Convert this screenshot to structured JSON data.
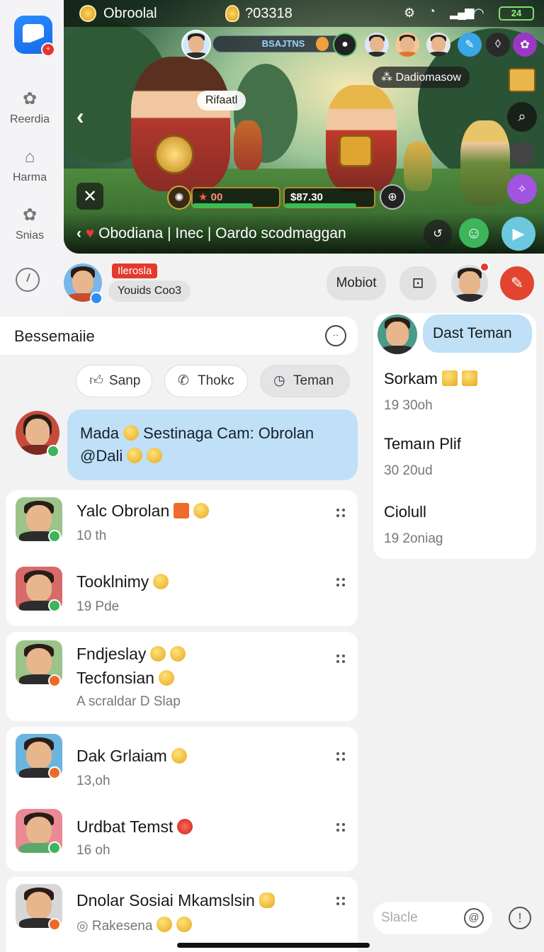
{
  "rail": {
    "items": [
      {
        "label": "Reerdia",
        "icon": "puzzle-icon"
      },
      {
        "label": "Harma",
        "icon": "home-icon"
      },
      {
        "label": "Snias",
        "icon": "puzzle-icon"
      }
    ]
  },
  "stream": {
    "coin_label": "Obroolal",
    "bulb_value": "?03318",
    "battery": "24",
    "hud_label": "BSAJTNS",
    "speech": "Rifaatl",
    "viewer_chip": "Dadiomasow",
    "hp_left": "00",
    "hp_right": "$87.30",
    "ticker": "Obodiana | Inec | Oardo scodmaggan",
    "accent": "#3cb55b"
  },
  "host": {
    "tag": "Ileroslа",
    "name": "Youids Coo3",
    "button": "Mobiot"
  },
  "search": {
    "title": "Bessemaiie"
  },
  "filters": [
    {
      "label": "Sanp",
      "icon": "thumbs-up-icon"
    },
    {
      "label": "Thokc",
      "icon": "phone-icon"
    },
    {
      "label": "Teman",
      "icon": "clock-icon"
    }
  ],
  "pinned": {
    "line1": "Mada",
    "line1b": "Sestinaga Cam: Obrolan",
    "line2": "@Dali"
  },
  "chats": [
    {
      "name": "Yalc Obrolan",
      "sub": "10 th"
    },
    {
      "name": "Tooklnimy",
      "sub": "19 Pde"
    },
    {
      "name": "Fndjeslay",
      "name2": "Tecfonsian",
      "sub": "A scraldar D Slap"
    },
    {
      "name": "Dak Grlaiam",
      "sub": "13,oh"
    },
    {
      "name": "Urdbat Temst",
      "sub": "16 oh"
    },
    {
      "name": "Dnolar Sosiai Mkamslsin",
      "sub": "Rakesena"
    }
  ],
  "right_panel": {
    "bubble": "Dast Teman",
    "items": [
      {
        "name": "Sorkam",
        "sub": "19 30oh"
      },
      {
        "name": "Temaın Plif",
        "sub": "30 20ud"
      },
      {
        "name": "Ciolull",
        "sub": "19 2oniag"
      }
    ]
  },
  "composer": {
    "placeholder": "Slacle"
  }
}
